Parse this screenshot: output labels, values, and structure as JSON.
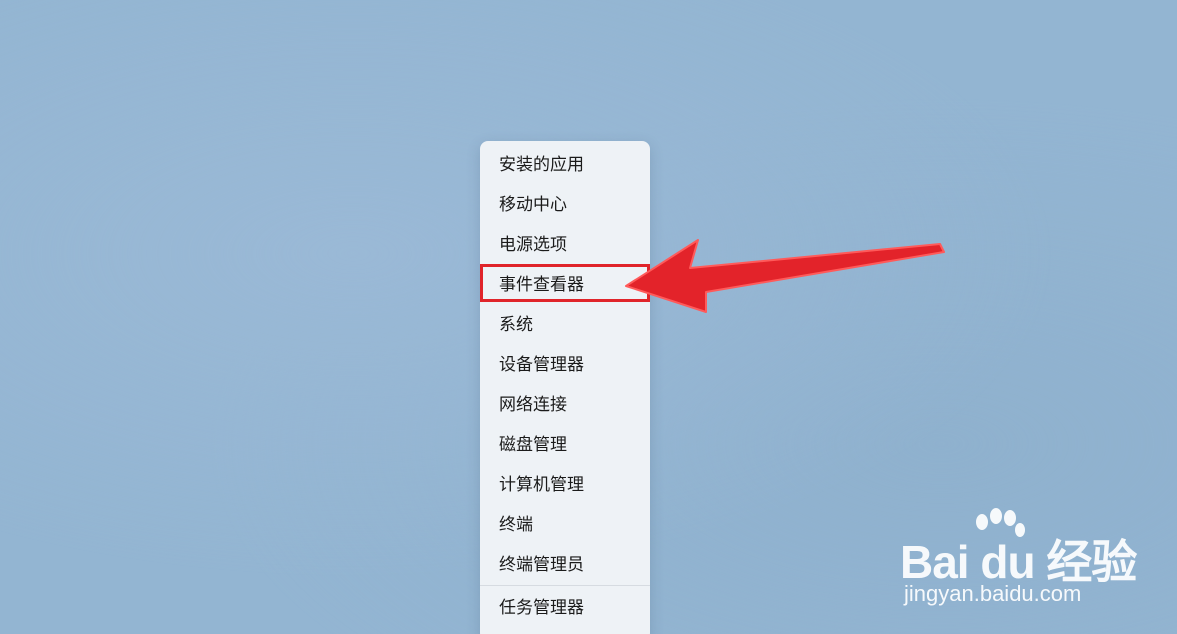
{
  "context_menu": {
    "items": [
      {
        "label": "安装的应用"
      },
      {
        "label": "移动中心"
      },
      {
        "label": "电源选项"
      },
      {
        "label": "事件查看器",
        "highlighted": true
      },
      {
        "label": "系统"
      },
      {
        "label": "设备管理器"
      },
      {
        "label": "网络连接"
      },
      {
        "label": "磁盘管理"
      },
      {
        "label": "计算机管理"
      },
      {
        "label": "终端"
      },
      {
        "label": "终端管理员"
      },
      {
        "label": "任务管理器"
      }
    ]
  },
  "annotation": {
    "highlight_color": "#e0242a",
    "arrow_icon": "red-arrow-icon"
  },
  "watermark": {
    "logo_text": "Bai du 经验",
    "url": "jingyan.baidu.com"
  }
}
